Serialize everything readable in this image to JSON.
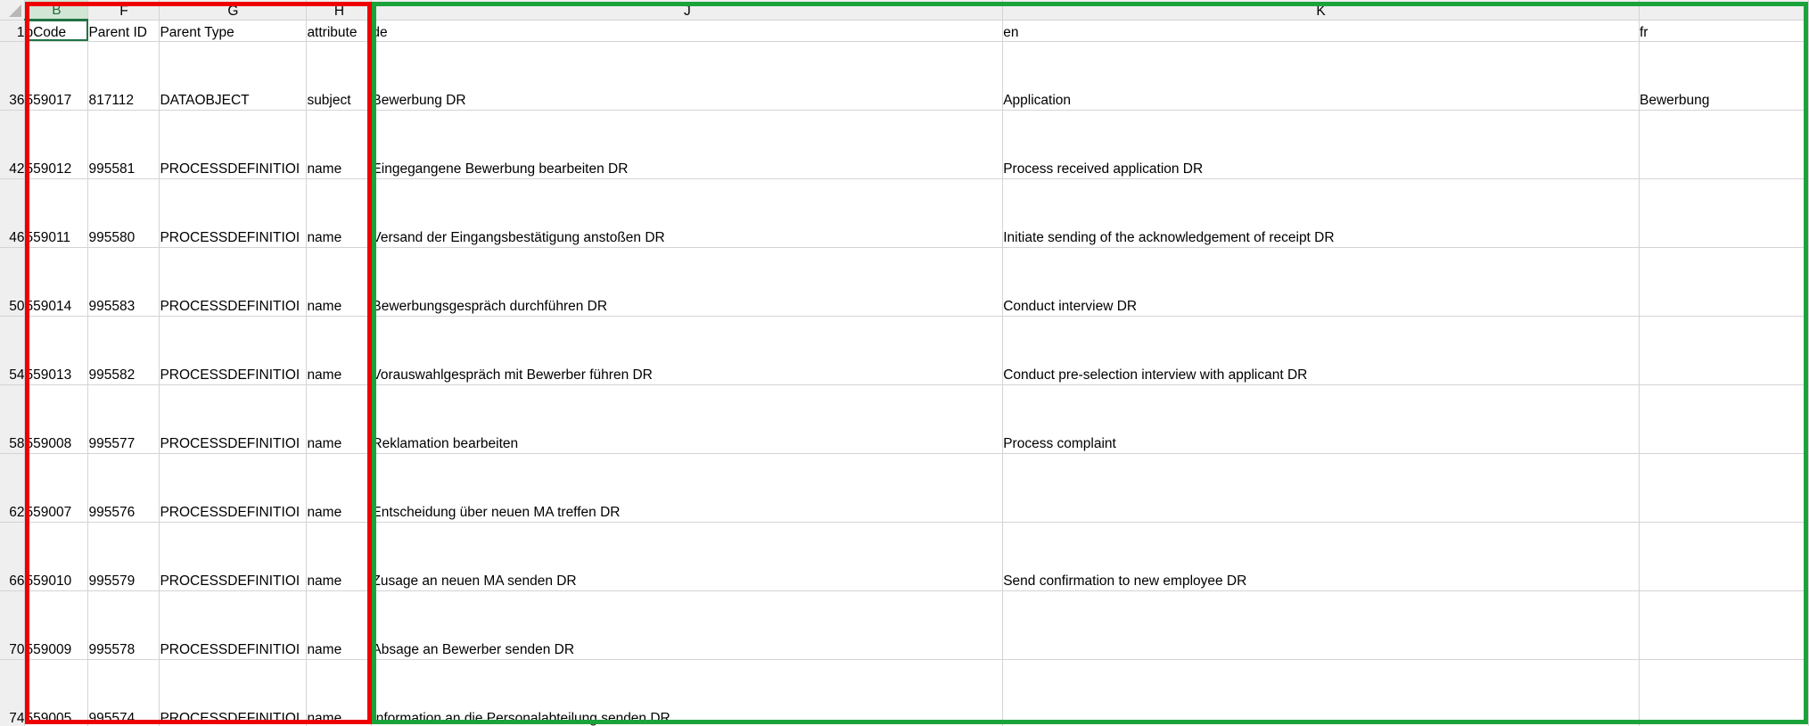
{
  "sheet": {
    "column_letters": [
      "B",
      "F",
      "G",
      "H",
      "J",
      "K",
      ""
    ],
    "active_column": "B",
    "header_row": {
      "row_number": "1",
      "cells": [
        "pCode",
        "Parent ID",
        "Parent Type",
        "attribute",
        "de",
        "en",
        "fr"
      ]
    },
    "rows": [
      {
        "row_number": "36",
        "cells": [
          "559017",
          "817112",
          "DATAOBJECT",
          "subject",
          "Bewerbung DR",
          "Application",
          "Bewerbung"
        ]
      },
      {
        "row_number": "42",
        "cells": [
          "559012",
          "995581",
          "PROCESSDEFINITIOI",
          "name",
          "Eingegangene Bewerbung bearbeiten DR",
          "Process received application DR",
          ""
        ]
      },
      {
        "row_number": "46",
        "cells": [
          "559011",
          "995580",
          "PROCESSDEFINITIOI",
          "name",
          "Versand der Eingangsbestätigung anstoßen DR",
          "Initiate sending of the acknowledgement of receipt DR",
          ""
        ]
      },
      {
        "row_number": "50",
        "cells": [
          "559014",
          "995583",
          "PROCESSDEFINITIOI",
          "name",
          "Bewerbungsgespräch durchführen DR",
          "Conduct interview DR",
          ""
        ]
      },
      {
        "row_number": "54",
        "cells": [
          "559013",
          "995582",
          "PROCESSDEFINITIOI",
          "name",
          "Vorauswahlgespräch mit Bewerber führen DR",
          "Conduct pre-selection interview with applicant DR",
          ""
        ]
      },
      {
        "row_number": "58",
        "cells": [
          "559008",
          "995577",
          "PROCESSDEFINITIOI",
          "name",
          "Reklamation bearbeiten",
          "Process complaint",
          ""
        ]
      },
      {
        "row_number": "62",
        "cells": [
          "559007",
          "995576",
          "PROCESSDEFINITIOI",
          "name",
          "Entscheidung über neuen MA treffen DR",
          "",
          ""
        ]
      },
      {
        "row_number": "66",
        "cells": [
          "559010",
          "995579",
          "PROCESSDEFINITIOI",
          "name",
          "Zusage an neuen MA senden DR",
          "Send confirmation to new employee DR",
          ""
        ]
      },
      {
        "row_number": "70",
        "cells": [
          "559009",
          "995578",
          "PROCESSDEFINITIOI",
          "name",
          "Absage an Bewerber senden DR",
          "",
          ""
        ]
      },
      {
        "row_number": "74",
        "cells": [
          "559005",
          "995574",
          "PROCESSDEFINITIOI",
          "name",
          "Information an die Personalabteilung senden DR",
          "",
          ""
        ]
      }
    ]
  },
  "highlights": {
    "red_box_color": "#ee0000",
    "green_box_color": "#1aa33a"
  }
}
